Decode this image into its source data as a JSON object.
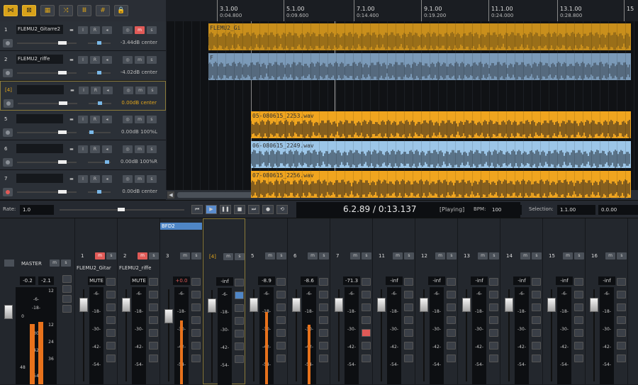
{
  "toolbar": {
    "buttons": [
      {
        "icon": "waveform-icon",
        "glyph": "⋈",
        "active": true
      },
      {
        "icon": "loop-icon",
        "glyph": "⊠",
        "active": true
      },
      {
        "icon": "grid-icon",
        "glyph": "▦",
        "active": false
      },
      {
        "icon": "automation-icon",
        "glyph": "⤨",
        "active": false
      },
      {
        "icon": "bars-icon",
        "glyph": "Ⅲ",
        "active": false
      },
      {
        "icon": "snap-icon",
        "glyph": "#",
        "active": false
      },
      {
        "icon": "lock-icon",
        "glyph": "🔒",
        "active": false
      }
    ]
  },
  "tracks": [
    {
      "num": "1",
      "name": "FLEMU2_Gitarre2",
      "volume": "-3.44dB",
      "pan": "center",
      "rec": false,
      "highlight": false,
      "selected": false,
      "muted": true
    },
    {
      "num": "2",
      "name": "FLEMU2_riffe",
      "volume": "-4.02dB",
      "pan": "center",
      "rec": false,
      "highlight": false,
      "selected": false,
      "muted": false
    },
    {
      "num": "[4]",
      "name": "",
      "volume": "0.00dB",
      "pan": "center",
      "rec": false,
      "highlight": true,
      "selected": true,
      "muted": false
    },
    {
      "num": "5",
      "name": "",
      "volume": "0.00dB",
      "pan": "100%L",
      "rec": false,
      "highlight": false,
      "selected": false,
      "muted": false
    },
    {
      "num": "6",
      "name": "",
      "volume": "0.00dB",
      "pan": "100%R",
      "rec": false,
      "highlight": false,
      "selected": false,
      "muted": false
    },
    {
      "num": "7",
      "name": "",
      "volume": "0.00dB",
      "pan": "center",
      "rec": true,
      "highlight": false,
      "selected": false,
      "muted": false
    }
  ],
  "ruler": [
    {
      "bar": "3.1.00",
      "time": "0:04.800"
    },
    {
      "bar": "5.1.00",
      "time": "0:09.600"
    },
    {
      "bar": "7.1.00",
      "time": "0:14.400"
    },
    {
      "bar": "9.1.00",
      "time": "0:19.200"
    },
    {
      "bar": "11.1.00",
      "time": "0:24.000"
    },
    {
      "bar": "13.1.00",
      "time": "0:28.800"
    },
    {
      "bar": "15",
      "time": ""
    }
  ],
  "clips": [
    {
      "label": "FLEMU2_Gi",
      "color": "#c98f1c",
      "wave": "#7a5a18",
      "row": 0
    },
    {
      "label": "F",
      "color": "#7b9ab8",
      "wave": "#3e4a57",
      "row": 1
    },
    {
      "label": "05-080615_2253.wav",
      "color": "#f0a51f",
      "wave": "#3d3020",
      "row": 3
    },
    {
      "label": "06-080615_2249.wav",
      "color": "#9cc6e8",
      "wave": "#2f3c48",
      "row": 4
    },
    {
      "label": "07-080615_2256.wav",
      "color": "#f0a51f",
      "wave": "#3d3020",
      "row": 5
    }
  ],
  "transport": {
    "rate_label": "Rate:",
    "rate_value": "1.0",
    "time_display": "6.2.89 / 0:13.137",
    "status": "[Playing]",
    "bpm_label": "BPM:",
    "bpm_value": "100",
    "selection_label": "Selection:",
    "selection_start": "1.1.00",
    "selection_end": "0.0.00",
    "buttons": [
      {
        "icon": "go-start-icon",
        "glyph": "⏮"
      },
      {
        "icon": "play-icon",
        "glyph": "▶"
      },
      {
        "icon": "pause-icon",
        "glyph": "❚❚"
      },
      {
        "icon": "stop-icon",
        "glyph": "■"
      },
      {
        "icon": "go-end-icon",
        "glyph": "⏭"
      },
      {
        "icon": "record-icon",
        "glyph": "●"
      },
      {
        "icon": "repeat-icon",
        "glyph": "⟲"
      }
    ]
  },
  "mixer": {
    "master": {
      "label": "MASTER",
      "peak_l": "-0.2",
      "peak_r": "-2.1",
      "level_l": 0.77,
      "level_r": 0.8
    },
    "bfd_label": "BFD2",
    "mute_text": "MUTE",
    "strips": [
      {
        "num": "1",
        "name": "FLEMU2_Gitar",
        "peak": "MUTE",
        "level": 0,
        "mute_red": true,
        "selected": false
      },
      {
        "num": "2",
        "name": "FLEMU2_riffe",
        "peak": "MUTE",
        "level": 0,
        "mute_red": true,
        "selected": false
      },
      {
        "num": "3",
        "name": "",
        "peak": "+0.0",
        "level": 0.75,
        "mute_red": false,
        "selected": false
      },
      {
        "num": "[4]",
        "name": "",
        "peak": "-inf",
        "level": 0,
        "mute_red": false,
        "selected": true
      },
      {
        "num": "5",
        "name": "",
        "peak": "-8.9",
        "level": 0.85,
        "mute_red": false,
        "selected": false
      },
      {
        "num": "6",
        "name": "",
        "peak": "-8.6",
        "level": 0.7,
        "mute_red": false,
        "selected": false
      },
      {
        "num": "7",
        "name": "",
        "peak": "-71.3",
        "level": 0,
        "mute_red": false,
        "selected": false
      },
      {
        "num": "11",
        "name": "",
        "peak": "-inf",
        "level": 0,
        "mute_red": false,
        "selected": false
      },
      {
        "num": "12",
        "name": "",
        "peak": "-inf",
        "level": 0,
        "mute_red": false,
        "selected": false
      },
      {
        "num": "13",
        "name": "",
        "peak": "-inf",
        "level": 0,
        "mute_red": false,
        "selected": false
      },
      {
        "num": "14",
        "name": "",
        "peak": "-inf",
        "level": 0,
        "mute_red": false,
        "selected": false
      },
      {
        "num": "15",
        "name": "",
        "peak": "-inf",
        "level": 0,
        "mute_red": false,
        "selected": false
      },
      {
        "num": "16",
        "name": "",
        "peak": "-inf",
        "level": 0,
        "mute_red": false,
        "selected": false
      }
    ],
    "scale": [
      "-6-",
      "-18-",
      "-30-",
      "-42-",
      "-54-"
    ],
    "master_scale": [
      "12",
      "-6-",
      "-18-",
      "0",
      "12",
      "-30-",
      "24",
      "-42-",
      "36",
      "48",
      "-54-"
    ]
  },
  "colors": {
    "accent": "#e0a51c",
    "mute_red": "#e05a57",
    "blue": "#5b8ccc",
    "meter": "#e8721c"
  }
}
